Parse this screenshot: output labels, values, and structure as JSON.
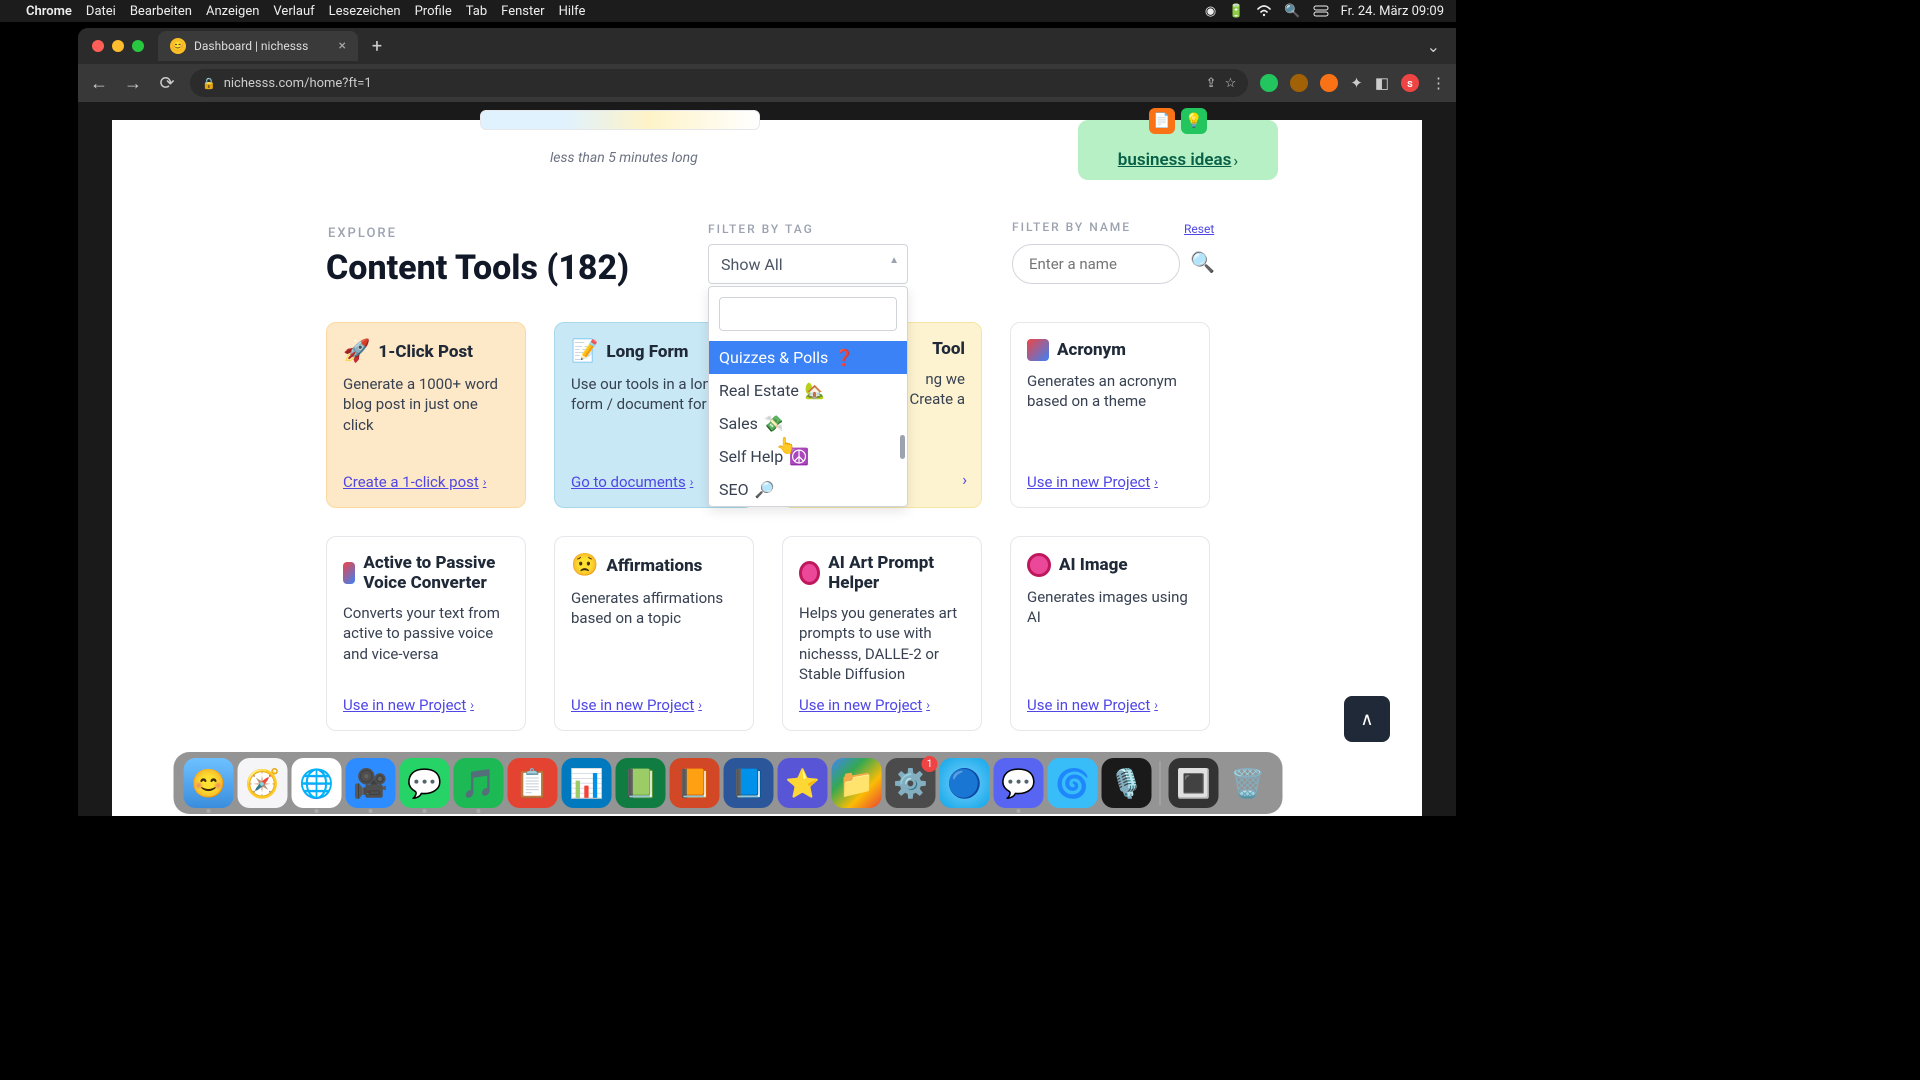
{
  "menubar": {
    "app": "Chrome",
    "items": [
      "Datei",
      "Bearbeiten",
      "Anzeigen",
      "Verlauf",
      "Lesezeichen",
      "Profile",
      "Tab",
      "Fenster",
      "Hilfe"
    ],
    "clock": "Fr. 24. März 09:09"
  },
  "tab": {
    "title": "Dashboard | nichesss"
  },
  "address": "nichesss.com/home?ft=1",
  "top": {
    "video_caption": "less than 5 minutes long",
    "business_link": "business ideas"
  },
  "explore_label": "EXPLORE",
  "heading": "Content Tools (182)",
  "filter_tag_label": "FILTER BY TAG",
  "filter_name_label": "FILTER BY NAME",
  "reset": "Reset",
  "select_value": "Show All",
  "name_placeholder": "Enter a name",
  "dropdown": {
    "options": [
      {
        "label": "Quizzes & Polls",
        "emoji": "❓",
        "selected": true
      },
      {
        "label": "Real Estate",
        "emoji": "🏡",
        "selected": false
      },
      {
        "label": "Sales",
        "emoji": "💸",
        "selected": false
      },
      {
        "label": "Self Help",
        "emoji": "☮️",
        "selected": false
      },
      {
        "label": "SEO",
        "emoji": "🔎",
        "selected": false
      }
    ]
  },
  "cards": [
    {
      "emoji": "🚀",
      "title": "1-Click Post",
      "body": "Generate a 1000+ word blog post in just one click",
      "link": "Create a 1-click post",
      "variant": "orange"
    },
    {
      "emoji": "📝",
      "title": "Long Form",
      "body": "Use our tools in a long form / document for",
      "link": "Go to documents",
      "variant": "blue"
    },
    {
      "emoji": "",
      "title": "Tool",
      "body": "ng we\nCreate a",
      "link": "",
      "variant": "yellow"
    },
    {
      "emoji": "abc",
      "title": "Acronym",
      "body": "Generates an acronym based on a theme",
      "link": "Use in new Project",
      "variant": ""
    },
    {
      "emoji": "abc",
      "title": "Active to Passive Voice Converter",
      "body": "Converts your text from active to passive voice and vice-versa",
      "link": "Use in new Project",
      "variant": ""
    },
    {
      "emoji": "😟",
      "title": "Affirmations",
      "body": "Generates affirmations based on a topic",
      "link": "Use in new Project",
      "variant": ""
    },
    {
      "emoji": "art",
      "title": "AI Art Prompt Helper",
      "body": "Helps you generates art prompts to use with nichesss, DALLE-2 or Stable Diffusion",
      "link": "Use in new Project",
      "variant": ""
    },
    {
      "emoji": "art",
      "title": "AI Image",
      "body": "Generates images using AI",
      "link": "Use in new Project",
      "variant": ""
    }
  ],
  "dock": {
    "badge": "1"
  }
}
